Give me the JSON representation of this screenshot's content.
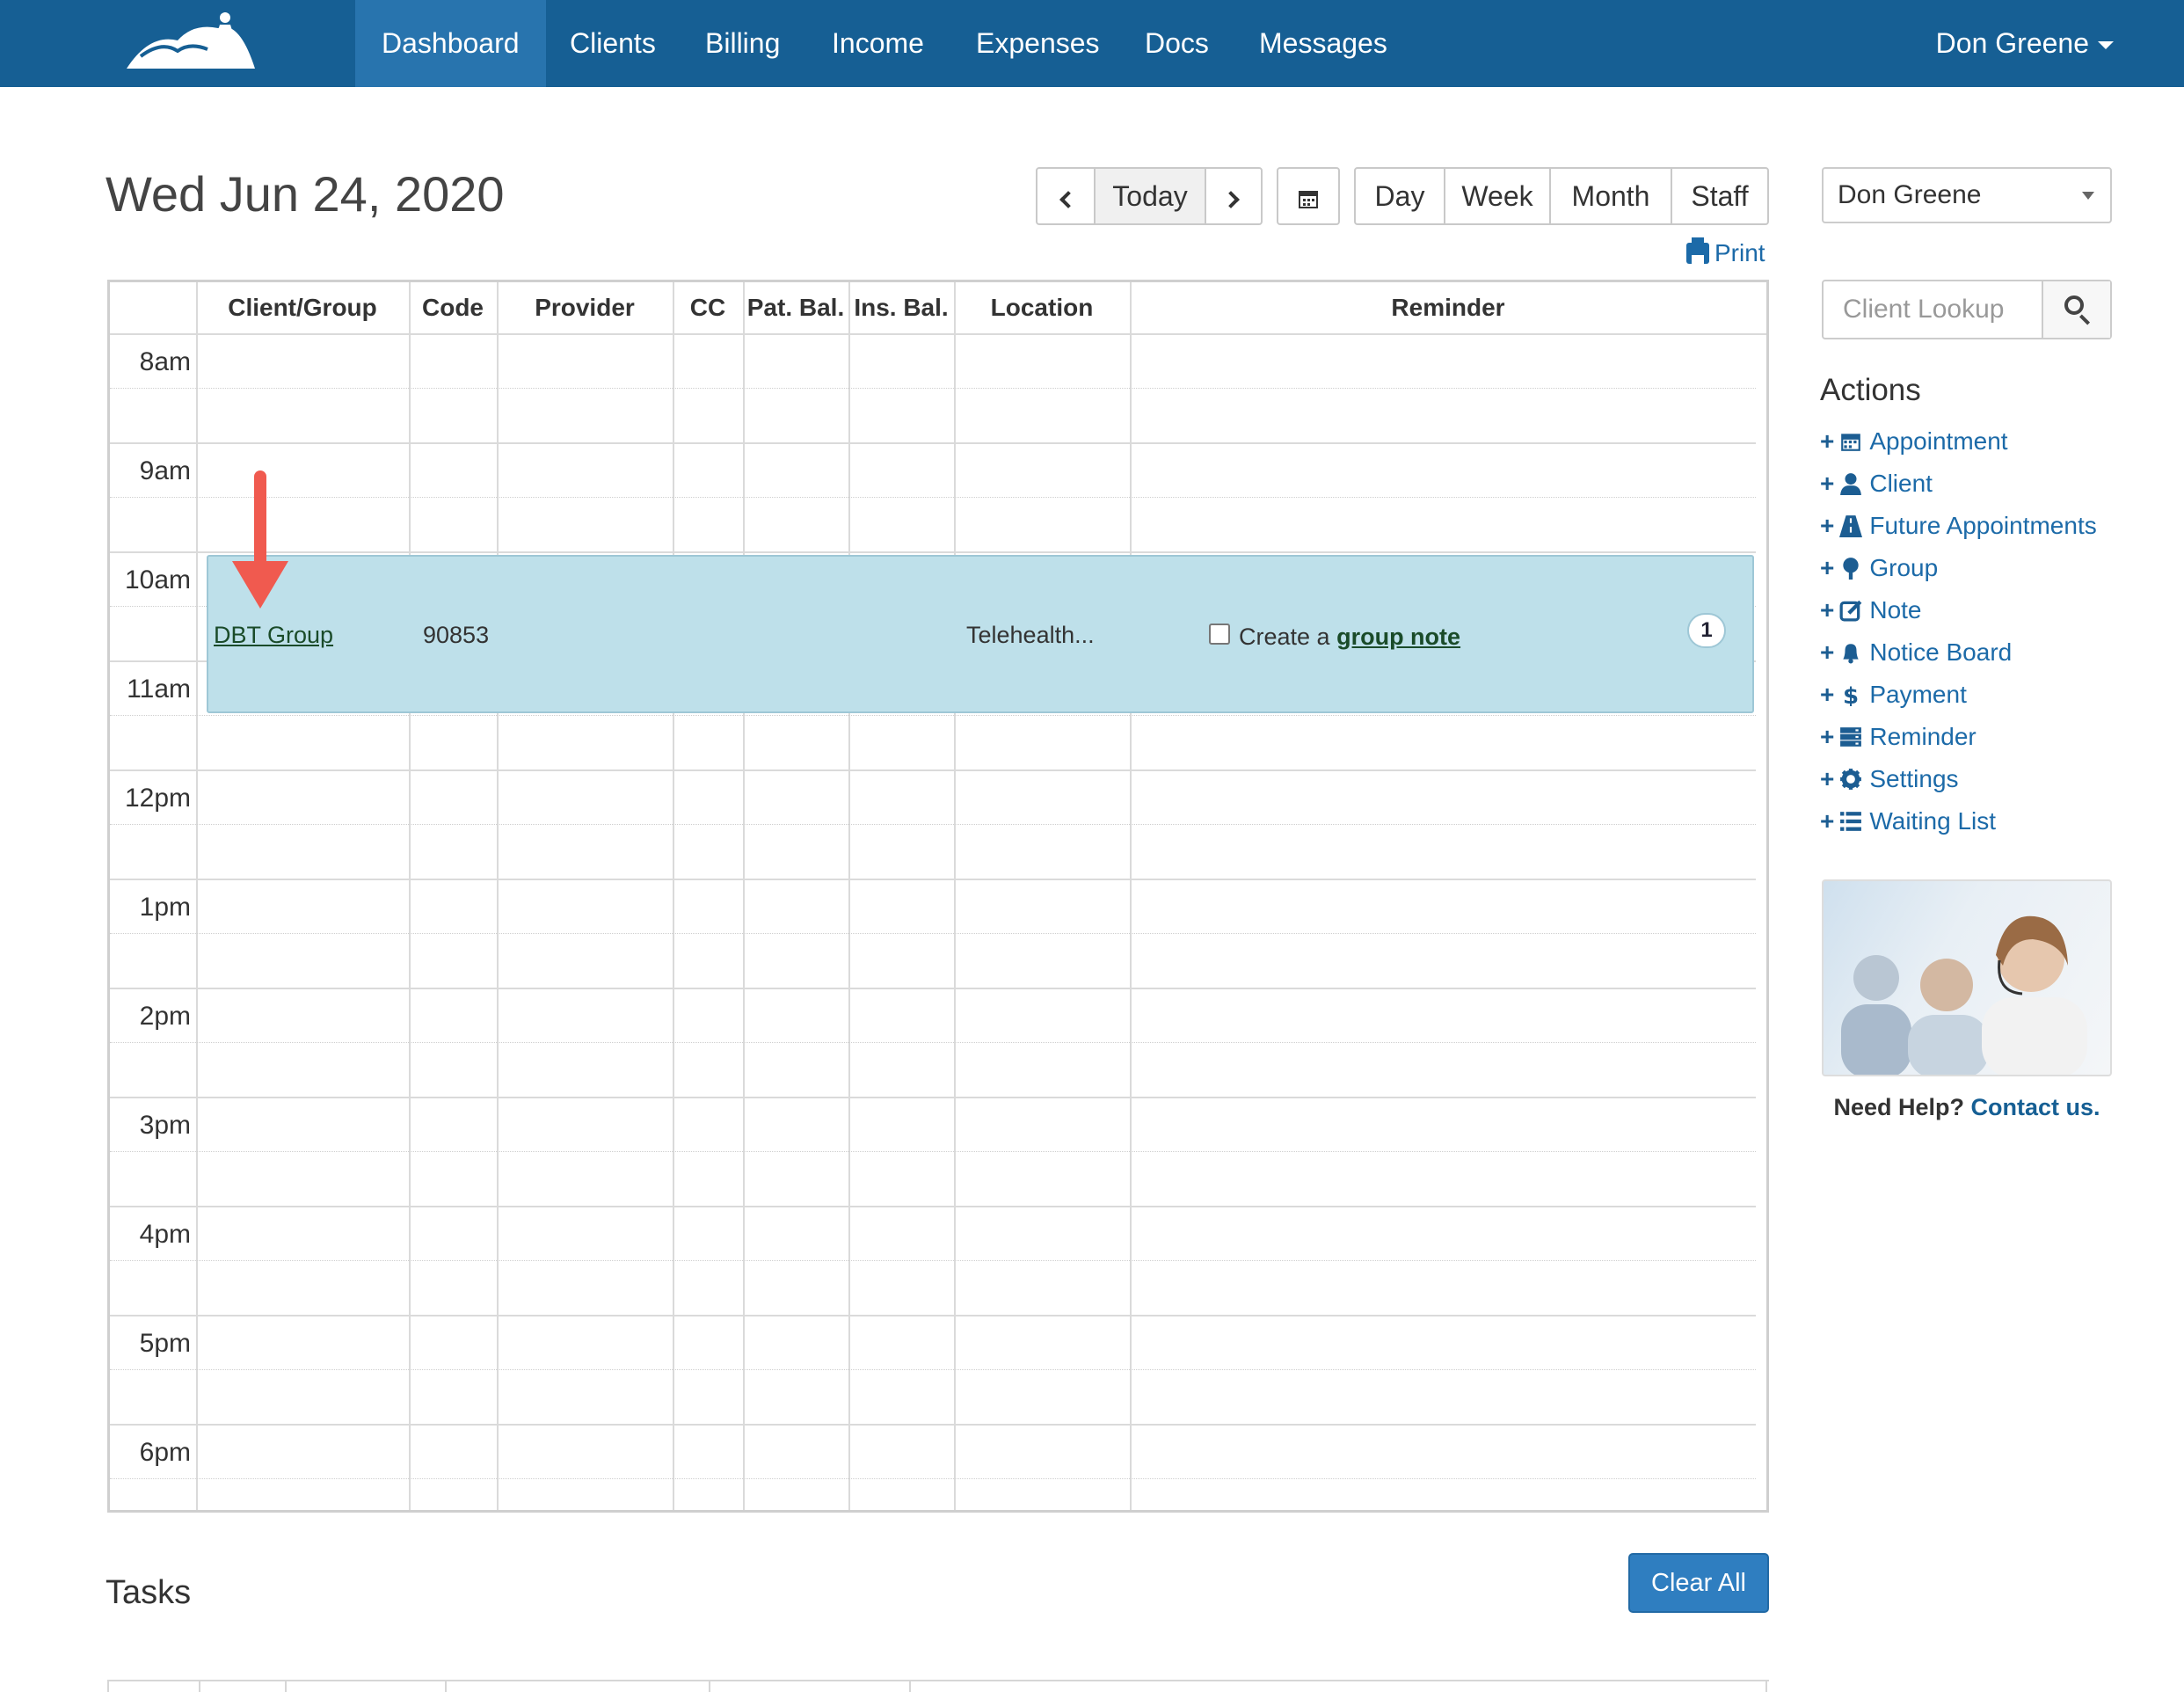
{
  "nav": {
    "items": [
      "Dashboard",
      "Clients",
      "Billing",
      "Income",
      "Expenses",
      "Docs",
      "Messages"
    ],
    "active": "Dashboard",
    "user": "Don Greene"
  },
  "header": {
    "date": "Wed Jun 24, 2020",
    "today_label": "Today",
    "views": [
      "Day",
      "Week",
      "Month",
      "Staff"
    ],
    "print_label": "Print"
  },
  "schedule": {
    "columns": [
      "Client/Group",
      "Code",
      "Provider",
      "CC",
      "Pat. Bal.",
      "Ins. Bal.",
      "Location",
      "Reminder"
    ],
    "times": [
      "8am",
      "9am",
      "10am",
      "11am",
      "12pm",
      "1pm",
      "2pm",
      "3pm",
      "4pm",
      "5pm",
      "6pm"
    ],
    "appointment": {
      "client_group": "DBT Group",
      "code": "90853",
      "location": "Telehealth...",
      "note_prefix": "Create a",
      "note_link": "group note",
      "badge": "1",
      "checked": false
    }
  },
  "tasks": {
    "title": "Tasks",
    "clear_label": "Clear All"
  },
  "sidebar": {
    "staff_select": "Don Greene",
    "lookup_placeholder": "Client Lookup",
    "actions_title": "Actions",
    "actions": [
      {
        "label": "Appointment",
        "icon": "calendar-icon"
      },
      {
        "label": "Client",
        "icon": "user-icon"
      },
      {
        "label": "Future Appointments",
        "icon": "road-icon"
      },
      {
        "label": "Group",
        "icon": "tree-icon"
      },
      {
        "label": "Note",
        "icon": "edit-icon"
      },
      {
        "label": "Notice Board",
        "icon": "bell-icon"
      },
      {
        "label": "Payment",
        "icon": "dollar-icon"
      },
      {
        "label": "Reminder",
        "icon": "server-icon"
      },
      {
        "label": "Settings",
        "icon": "gear-icon"
      },
      {
        "label": "Waiting List",
        "icon": "list-icon"
      }
    ],
    "help_text": "Need Help?",
    "help_link": "Contact us."
  },
  "colors": {
    "nav_bg": "#165f94",
    "nav_active": "#2874ae",
    "appointment_bg": "#bee0ea",
    "link": "#1c6aa8",
    "primary_button": "#2f7ec0"
  }
}
